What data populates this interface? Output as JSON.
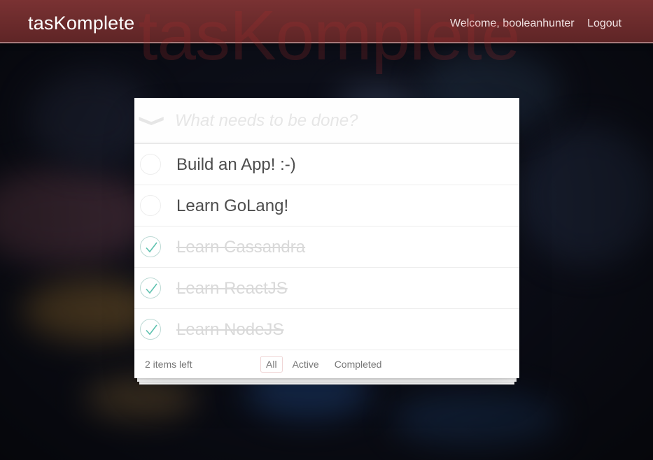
{
  "header": {
    "brand": "tasKomplete",
    "welcome": "Welcome, booleanhunter",
    "logout": "Logout",
    "ghost_title": "tasKomplete",
    "color": "#6e2c2d"
  },
  "todo": {
    "toggle_all_icon": "chevron-down-icon",
    "new_todo_placeholder": "What needs to be done?",
    "new_todo_value": "",
    "items": [
      {
        "title": "Build an App! :-)",
        "completed": false
      },
      {
        "title": "Learn GoLang!",
        "completed": false
      },
      {
        "title": "Learn Cassandra",
        "completed": true
      },
      {
        "title": "Learn ReactJS",
        "completed": true
      },
      {
        "title": "Learn NodeJS",
        "completed": true
      }
    ],
    "footer": {
      "count_label": "2 items left",
      "filters": [
        {
          "label": "All",
          "selected": true
        },
        {
          "label": "Active",
          "selected": false
        },
        {
          "label": "Completed",
          "selected": false
        }
      ]
    }
  },
  "colors": {
    "check_accent": "#5dc2af",
    "completed_text": "#d9d9d9",
    "text": "#4d4d4d"
  }
}
